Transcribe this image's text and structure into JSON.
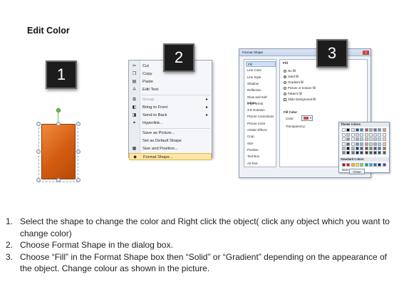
{
  "title": "Edit Color",
  "badges": [
    "1",
    "2",
    "3"
  ],
  "context_menu": {
    "items": [
      {
        "icon": "scissors-icon",
        "glyph": "✂",
        "label": "Cut",
        "submenu": false,
        "disabled": false
      },
      {
        "icon": "copy-icon",
        "glyph": "❐",
        "label": "Copy",
        "submenu": false,
        "disabled": false
      },
      {
        "icon": "paste-icon",
        "glyph": "▤",
        "label": "Paste",
        "submenu": false,
        "disabled": false
      },
      {
        "icon": "edit-text-icon",
        "glyph": "A",
        "label": "Edit Text",
        "submenu": false,
        "disabled": false
      },
      {
        "icon": "group-icon",
        "glyph": "⧉",
        "label": "Group",
        "submenu": true,
        "disabled": true
      },
      {
        "icon": "bring-front-icon",
        "glyph": "◧",
        "label": "Bring to Front",
        "submenu": true,
        "disabled": false
      },
      {
        "icon": "send-back-icon",
        "glyph": "◨",
        "label": "Send to Back",
        "submenu": true,
        "disabled": false
      },
      {
        "icon": "hyperlink-icon",
        "glyph": "⚭",
        "label": "Hyperlink...",
        "submenu": false,
        "disabled": false
      },
      {
        "icon": "",
        "glyph": "",
        "label": "Save as Picture...",
        "submenu": false,
        "disabled": false
      },
      {
        "icon": "",
        "glyph": "",
        "label": "Set as Default Shape",
        "submenu": false,
        "disabled": false
      },
      {
        "icon": "size-position-icon",
        "glyph": "▦",
        "label": "Size and Position...",
        "submenu": false,
        "disabled": false
      },
      {
        "icon": "format-shape-icon",
        "glyph": "◆",
        "label": "Format Shape...",
        "submenu": false,
        "disabled": false,
        "highlight": true
      }
    ]
  },
  "dialog": {
    "title": "Format Shape",
    "close": "x",
    "categories": [
      "Fill",
      "Line Color",
      "Line Style",
      "Shadow",
      "Reflection",
      "Glow and Soft Edges",
      "3-D Format",
      "3-D Rotation",
      "Picture Corrections",
      "Picture Color",
      "Artistic Effects",
      "Crop",
      "Size",
      "Position",
      "Text Box",
      "Alt Text"
    ],
    "selected_category": "Fill",
    "fill_heading": "Fill",
    "options": [
      {
        "type": "radio",
        "label": "No fill",
        "checked": false
      },
      {
        "type": "radio",
        "label": "Solid fill",
        "checked": true
      },
      {
        "type": "radio",
        "label": "Gradient fill",
        "checked": false
      },
      {
        "type": "radio",
        "label": "Picture or texture fill",
        "checked": false
      },
      {
        "type": "radio",
        "label": "Pattern fill",
        "checked": false
      },
      {
        "type": "checkbox",
        "label": "Slide background fill",
        "checked": false
      }
    ],
    "fill_color_heading": "Fill Color",
    "color_label": "Color:",
    "transparency_label": "Transparency:",
    "theme_colors_label": "Theme Colors",
    "standard_colors_label": "Standard Colors",
    "more_colors_label": "More Colors...",
    "close_button": "Close",
    "theme_colors": [
      "#ffffff",
      "#000000",
      "#eeece1",
      "#1f497d",
      "#4f81bd",
      "#c0504d",
      "#9bbb59",
      "#8064a2",
      "#4bacc6",
      "#f79646"
    ],
    "standard_colors": [
      "#c00000",
      "#ff0000",
      "#ffc000",
      "#ffff00",
      "#92d050",
      "#00b050",
      "#00b0f0",
      "#0070c0",
      "#002060",
      "#7030a0"
    ],
    "selected_color": "#c0504d"
  },
  "steps": [
    {
      "num": "1.",
      "text": "Select the shape to change the color and Right click the object( click any object which you want to change color)"
    },
    {
      "num": "2.",
      "text": "Choose Format Shape in the dialog box."
    },
    {
      "num": "3.",
      "text": "Choose “Fill” in the Format Shape box then “Solid” or “Gradient” depending on the appearance of the object. Change colour as shown in the picture."
    }
  ]
}
